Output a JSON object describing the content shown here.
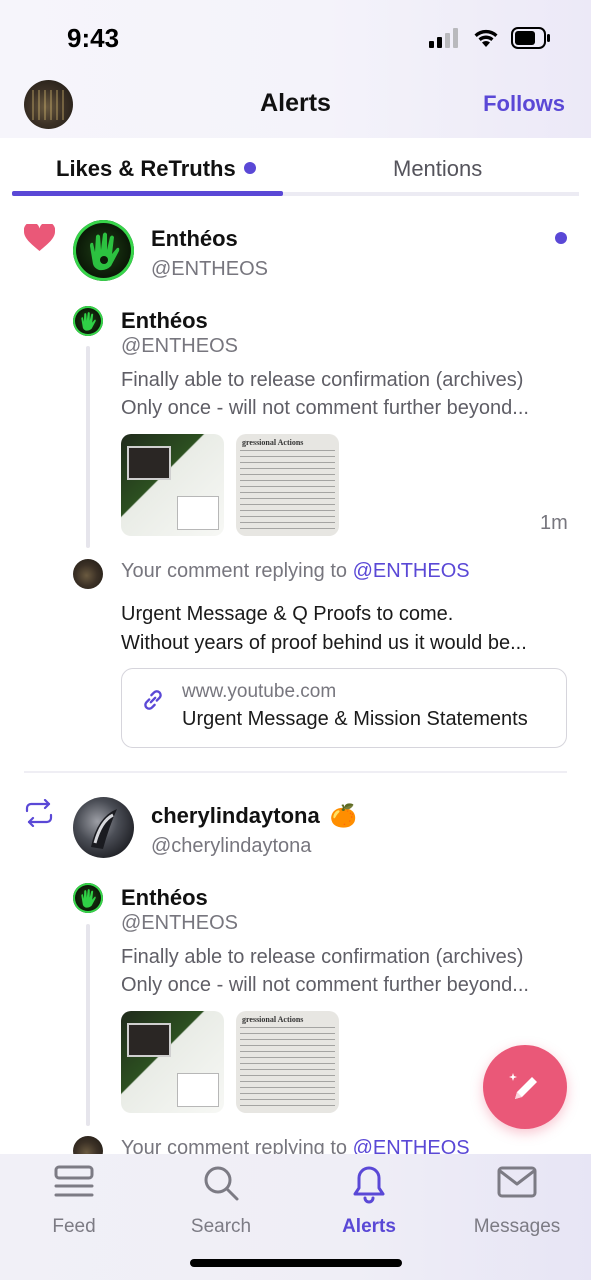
{
  "status_bar": {
    "time": "9:43"
  },
  "header": {
    "title": "Alerts",
    "follows_label": "Follows"
  },
  "tabs": [
    {
      "label": "Likes & ReTruths",
      "active": true
    },
    {
      "label": "Mentions",
      "active": false
    }
  ],
  "notifications": [
    {
      "type": "like",
      "actor_name": "Enthéos",
      "actor_handle": "@ENTHEOS",
      "unread": true,
      "post": {
        "author_name": "Enthéos",
        "author_handle": "@ENTHEOS",
        "text_line1": "Finally able to release confirmation (archives)",
        "text_line2": "Only once - will not comment further beyond...",
        "time": "1m",
        "thumb_title": "gressional Actions"
      },
      "reply": {
        "prefix": "Your comment replying to ",
        "mention": "@ENTHEOS",
        "text_line1": "Urgent Message & Q Proofs to come.",
        "text_line2": "Without years of proof behind us it would be...",
        "link_domain": "www.youtube.com",
        "link_title": "Urgent Message & Mission Statements"
      }
    },
    {
      "type": "retruth",
      "actor_name": "cherylindaytona",
      "actor_emoji": "🍊",
      "actor_handle": "@cherylindaytona",
      "post": {
        "author_name": "Enthéos",
        "author_handle": "@ENTHEOS",
        "text_line1": "Finally able to release confirmation (archives)",
        "text_line2": "Only once - will not comment further beyond...",
        "thumb_title": "gressional Actions"
      },
      "reply": {
        "prefix": "Your comment replying to ",
        "mention": "@ENTHEOS"
      }
    }
  ],
  "bottom_nav": [
    {
      "label": "Feed",
      "icon": "feed-icon",
      "active": false
    },
    {
      "label": "Search",
      "icon": "search-icon",
      "active": false
    },
    {
      "label": "Alerts",
      "icon": "bell-icon",
      "active": true
    },
    {
      "label": "Messages",
      "icon": "envelope-icon",
      "active": false
    }
  ],
  "colors": {
    "accent": "#5a48d6",
    "heart": "#ea5878",
    "fab": "#ea5878"
  }
}
